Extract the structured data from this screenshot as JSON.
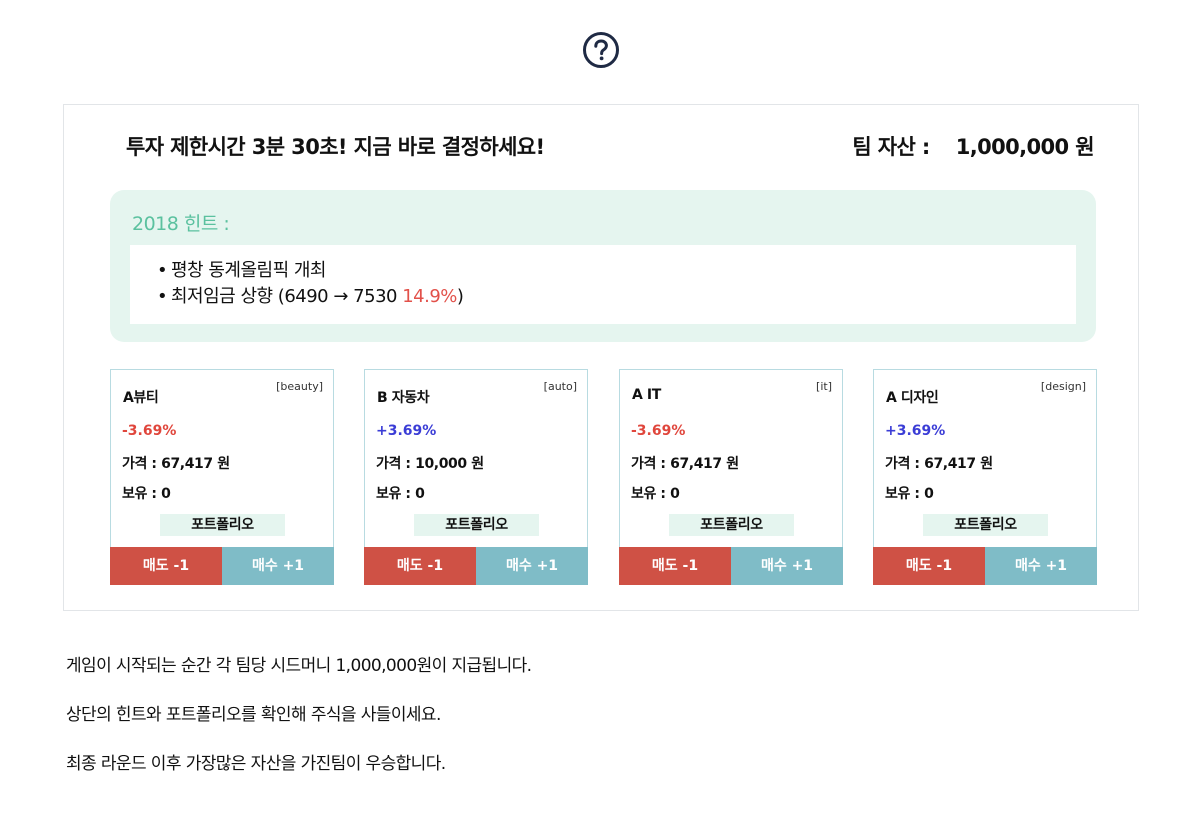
{
  "help_icon": "question-circle-icon",
  "header": {
    "title": "투자 제한시간 3분 30초! 지금 바로 결정하세요!",
    "team_asset_label": "팀 자산 :",
    "team_asset_value": "1,000,000 원"
  },
  "hint": {
    "title": "2018 힌트 :",
    "item1": "평창 동계올림픽 개최",
    "item2_prefix": "최저임금 상향 (6490 → 7530 ",
    "item2_pct": "14.9%",
    "item2_suffix": ")"
  },
  "cards": [
    {
      "name": "A뷰티",
      "category": "[beauty]",
      "change": "-3.69%",
      "price": "가격 : 67,417 원",
      "holding": "보유 : 0",
      "portfolio": "포트폴리오",
      "sell": "매도 -1",
      "buy": "매수 +1"
    },
    {
      "name": "B 자동차",
      "category": "[auto]",
      "change": "+3.69%",
      "price": "가격 : 10,000 원",
      "holding": "보유 : 0",
      "portfolio": "포트폴리오",
      "sell": "매도 -1",
      "buy": "매수 +1"
    },
    {
      "name": "A IT",
      "category": "[it]",
      "change": "-3.69%",
      "price": "가격 : 67,417 원",
      "holding": "보유 : 0",
      "portfolio": "포트폴리오",
      "sell": "매도 -1",
      "buy": "매수 +1"
    },
    {
      "name": "A 디자인",
      "category": "[design]",
      "change": "+3.69%",
      "price": "가격 : 67,417 원",
      "holding": "보유 : 0",
      "portfolio": "포트폴리오",
      "sell": "매도 -1",
      "buy": "매수 +1"
    }
  ],
  "footer": {
    "line1": "게임이 시작되는 순간 각 팀당 시드머니 1,000,000원이 지급됩니다.",
    "line2": "상단의 힌트와 포트폴리오를 확인해 주식을 사들이세요.",
    "line3": "최종 라운드 이후 가장많은 자산을 가진팀이 우승합니다."
  },
  "colors": {
    "sell": "#cf5145",
    "buy": "#7fbcc7",
    "negative": "#e0463c",
    "positive": "#3b3dd6",
    "hint_accent": "#5bc19f",
    "hint_bg": "#e5f5ef"
  }
}
